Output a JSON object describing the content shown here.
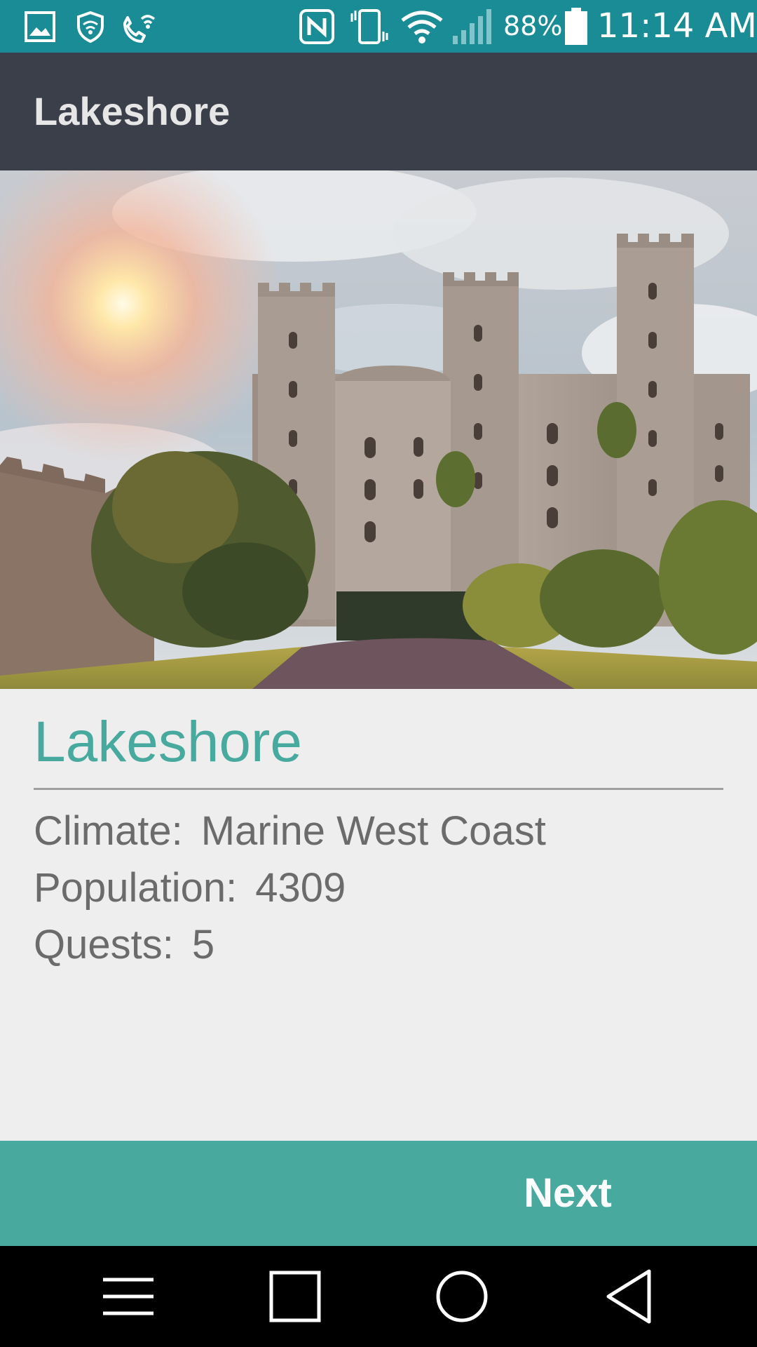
{
  "status_bar": {
    "battery_percent": "88%",
    "time": "11:14 AM",
    "left_icons": [
      "image-icon",
      "vpn-shield-icon",
      "wifi-calling-icon"
    ],
    "right_icons": [
      "nfc-icon",
      "vibrate-icon",
      "wifi-icon",
      "cell-signal-icon",
      "battery-icon"
    ],
    "background_color": "#1a8c96"
  },
  "app_bar": {
    "title": "Lakeshore",
    "background_color": "#3b3f4a"
  },
  "hero": {
    "subject": "castle-photo"
  },
  "place": {
    "name": "Lakeshore",
    "accent_color": "#48a99f",
    "details": [
      {
        "label": "Climate:",
        "value": "Marine West Coast"
      },
      {
        "label": "Population:",
        "value": "4309"
      },
      {
        "label": "Quests:",
        "value": "5"
      }
    ]
  },
  "footer": {
    "next_label": "Next",
    "background_color": "#48a99f"
  },
  "nav_bar": {
    "buttons": [
      "menu-icon",
      "recents-icon",
      "home-icon",
      "back-icon"
    ]
  }
}
